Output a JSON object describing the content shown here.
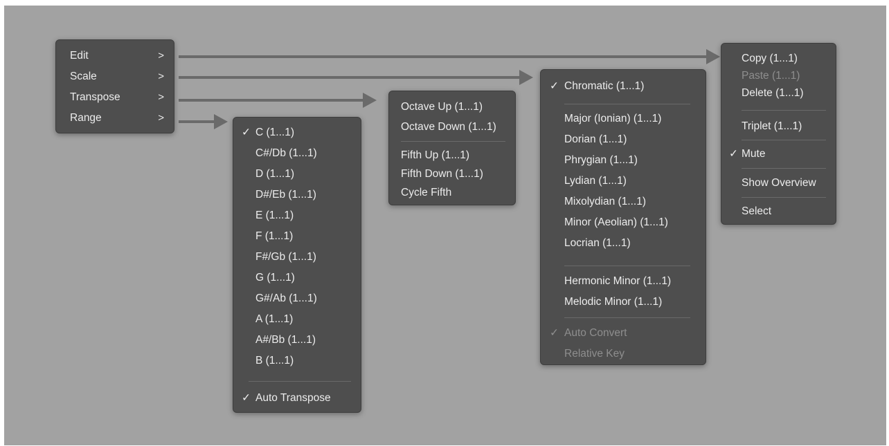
{
  "main_menu": {
    "items": [
      {
        "label": "Edit",
        "chevron": ">"
      },
      {
        "label": "Scale",
        "chevron": ">"
      },
      {
        "label": "Transpose",
        "chevron": ">"
      },
      {
        "label": "Range",
        "chevron": ">"
      }
    ]
  },
  "range_menu": {
    "items": [
      {
        "label": "C (1...1)",
        "checked": true
      },
      {
        "label": "C#/Db (1...1)"
      },
      {
        "label": "D (1...1)"
      },
      {
        "label": "D#/Eb (1...1)"
      },
      {
        "label": "E (1...1)"
      },
      {
        "label": "F (1...1)"
      },
      {
        "label": "F#/Gb (1...1)"
      },
      {
        "label": "G (1...1)"
      },
      {
        "label": "G#/Ab (1...1)"
      },
      {
        "label": "A (1...1)"
      },
      {
        "label": "A#/Bb (1...1)"
      },
      {
        "label": "B (1...1)"
      }
    ],
    "auto_transpose": {
      "label": "Auto Transpose",
      "checked": true
    }
  },
  "transpose_menu": {
    "items": [
      {
        "label": "Octave Up (1...1)"
      },
      {
        "label": "Octave Down (1...1)"
      },
      {
        "label": "Fifth Up (1...1)"
      },
      {
        "label": "Fifth Down (1...1)"
      },
      {
        "label": "Cycle Fifth"
      }
    ]
  },
  "scale_menu": {
    "chromatic": {
      "label": "Chromatic (1...1)",
      "checked": true
    },
    "modes": [
      {
        "label": "Major (Ionian) (1...1)"
      },
      {
        "label": "Dorian (1...1)"
      },
      {
        "label": "Phrygian (1...1)"
      },
      {
        "label": "Lydian (1...1)"
      },
      {
        "label": "Mixolydian (1...1)"
      },
      {
        "label": "Minor (Aeolian) (1...1)"
      },
      {
        "label": "Locrian (1...1)"
      }
    ],
    "minors": [
      {
        "label": "Hermonic Minor (1...1)"
      },
      {
        "label": "Melodic Minor (1...1)"
      }
    ],
    "auto_convert": {
      "label": "Auto Convert",
      "checked": true,
      "disabled": true
    },
    "relative_key": {
      "label": "Relative Key",
      "disabled": true
    }
  },
  "edit_menu": {
    "copy": {
      "label": "Copy (1...1)"
    },
    "paste": {
      "label": "Paste (1...1)",
      "disabled": true
    },
    "delete": {
      "label": "Delete (1...1)"
    },
    "triplet": {
      "label": "Triplet (1...1)"
    },
    "mute": {
      "label": "Mute",
      "checked": true
    },
    "show_overview": {
      "label": "Show Overview"
    },
    "select": {
      "label": "Select"
    }
  },
  "check_glyph": "✓",
  "colors": {
    "background": "#a2a2a2",
    "menu": "#4e4e4e",
    "text": "#ececec",
    "disabled_text": "#8e8e8e",
    "arrow": "#6a6a6a"
  }
}
